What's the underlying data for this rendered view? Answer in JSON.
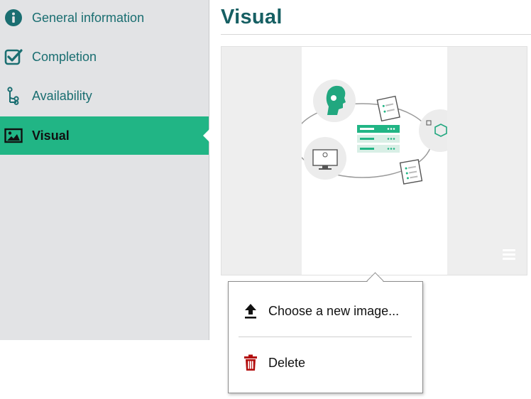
{
  "sidebar": {
    "items": [
      {
        "label": "General information",
        "icon": "info-circle-icon",
        "active": false
      },
      {
        "label": "Completion",
        "icon": "checkbox-checked-icon",
        "active": false
      },
      {
        "label": "Availability",
        "icon": "branch-icon",
        "active": false
      },
      {
        "label": "Visual",
        "icon": "image-icon",
        "active": true
      }
    ]
  },
  "main": {
    "title": "Visual"
  },
  "context_menu": {
    "items": [
      {
        "label": "Choose a new image...",
        "icon": "upload-icon"
      },
      {
        "label": "Delete",
        "icon": "trash-icon"
      }
    ]
  },
  "colors": {
    "accent": "#21b585",
    "title": "#165f63",
    "label": "#1a6e71",
    "sidebar_bg": "#e2e3e5",
    "delete": "#b30e0e"
  }
}
